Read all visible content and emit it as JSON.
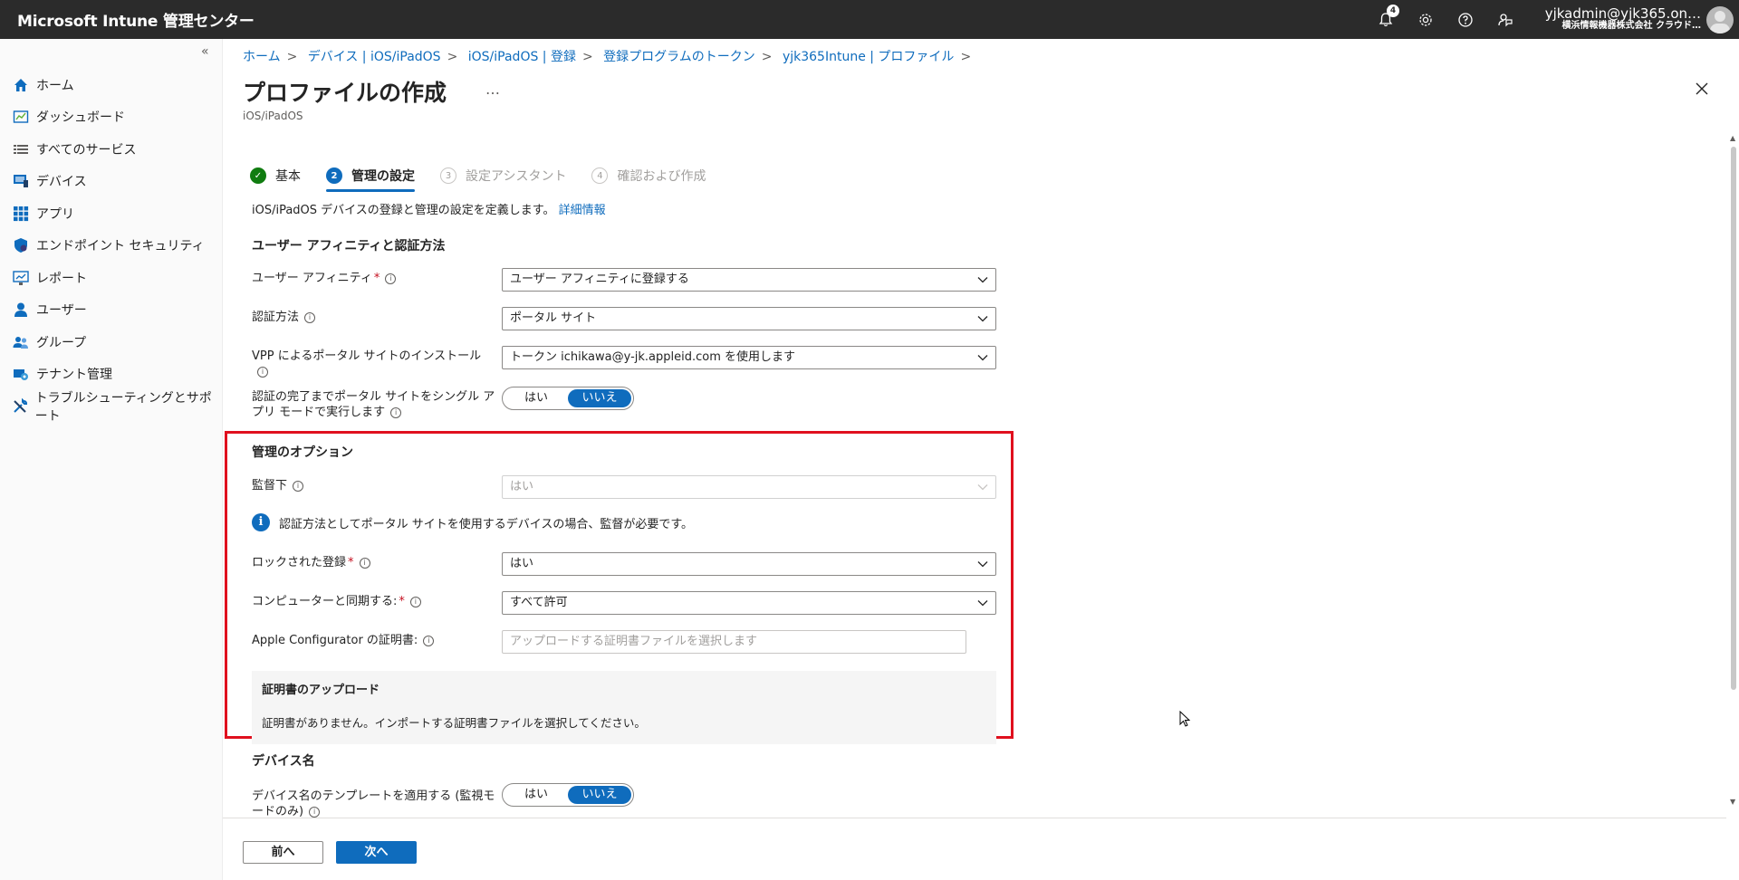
{
  "topbar": {
    "title": "Microsoft Intune 管理センター",
    "notification_count": "4",
    "user_email": "yjkadmin@yjk365.on…",
    "user_org": "横浜情報機器株式会社 クラウド…"
  },
  "sidebar": {
    "items": [
      {
        "label": "ホーム"
      },
      {
        "label": "ダッシュボード"
      },
      {
        "label": "すべてのサービス"
      },
      {
        "label": "デバイス"
      },
      {
        "label": "アプリ"
      },
      {
        "label": "エンドポイント セキュリティ"
      },
      {
        "label": "レポート"
      },
      {
        "label": "ユーザー"
      },
      {
        "label": "グループ"
      },
      {
        "label": "テナント管理"
      },
      {
        "label": "トラブルシューティングとサポート"
      }
    ]
  },
  "breadcrumb": [
    "ホーム",
    "デバイス | iOS/iPadOS",
    "iOS/iPadOS | 登録",
    "登録プログラムのトークン",
    "yjk365Intune | プロファイル"
  ],
  "page": {
    "title": "プロファイルの作成",
    "more": "…",
    "subtitle": "iOS/iPadOS"
  },
  "steps": [
    {
      "num": "✓",
      "label": "基本"
    },
    {
      "num": "2",
      "label": "管理の設定"
    },
    {
      "num": "3",
      "label": "設定アシスタント"
    },
    {
      "num": "4",
      "label": "確認および作成"
    }
  ],
  "description": {
    "text": "iOS/iPadOS デバイスの登録と管理の設定を定義します。",
    "link": "詳細情報"
  },
  "sections": {
    "affinity": "ユーザー アフィニティと認証方法",
    "management": "管理のオプション",
    "device_name": "デバイス名"
  },
  "fields": {
    "user_affinity": {
      "label": "ユーザー アフィニティ",
      "value": "ユーザー アフィニティに登録する"
    },
    "auth_method": {
      "label": "認証方法",
      "value": "ポータル サイト"
    },
    "vpp": {
      "label": "VPP によるポータル サイトのインストール",
      "value": "トークン ichikawa@y-jk.appleid.com を使用します"
    },
    "single_app": {
      "label": "認証の完了までポータル サイトをシングル アプリ モードで実行します",
      "yes": "はい",
      "no": "いいえ"
    },
    "supervised": {
      "label": "監督下",
      "value": "はい"
    },
    "supervised_info": "認証方法としてポータル サイトを使用するデバイスの場合、監督が必要です。",
    "locked_enrollment": {
      "label": "ロックされた登録",
      "value": "はい"
    },
    "sync_computer": {
      "label": "コンピューターと同期する:",
      "value": "すべて許可"
    },
    "configurator_cert": {
      "label": "Apple Configurator の証明書:",
      "placeholder": "アップロードする証明書ファイルを選択します"
    },
    "cert_upload_title": "証明書のアップロード",
    "cert_upload_msg": "証明書がありません。インポートする証明書ファイルを選択してください。",
    "device_name_template": {
      "label": "デバイス名のテンプレートを適用する (監視モードのみ)",
      "yes": "はい",
      "no": "いいえ"
    }
  },
  "footer": {
    "prev": "前へ",
    "next": "次へ"
  },
  "colors": {
    "accent": "#0f6cbd",
    "highlight": "#e0101e",
    "success": "#107c10"
  }
}
